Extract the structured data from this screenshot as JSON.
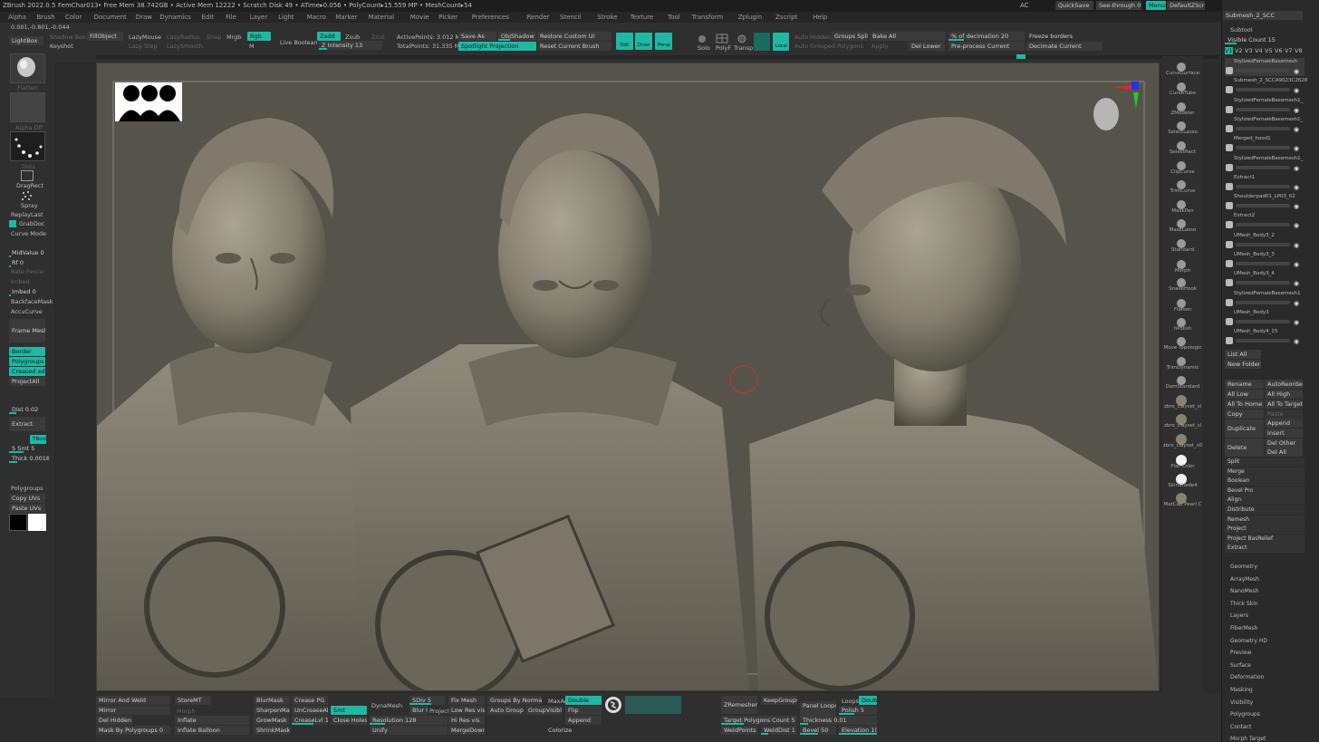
{
  "titlebar": {
    "app": "ZBrush 2022.0.5",
    "doc": "FemChar013",
    "stats": "• Free Mem 38.742GB • Active Mem 12222 • Scratch Disk 49 • ATime▸0.056 • PolyCount▸15.559 MP • MeshCount▸54",
    "ac": "AC",
    "quicksave": "QuickSave",
    "see_through": "See-through  0",
    "menus": "Menus",
    "default_zscript": "DefaultZScript",
    "subtool_tab": "Submesh_2_SCC"
  },
  "menubar": [
    "Alpha",
    "Brush",
    "Color",
    "Document",
    "Draw",
    "Dynamics",
    "Edit",
    "File",
    "Layer",
    "Light",
    "Macro",
    "Marker",
    "Material",
    "Movie",
    "Picker",
    "Preferences",
    "Render",
    "Stencil",
    "Stroke",
    "Texture",
    "Tool",
    "Transform",
    "Zplugin",
    "Zscript",
    "Help"
  ],
  "coords": "0.001,-0.801,-0.044",
  "toolbar": {
    "lightbox": "LightBox",
    "keyshot": "Keyshot",
    "shadow_box": "Shadow Box",
    "fill_object": "FillObject",
    "lazymouse": "LazyMouse",
    "lazy_step": "Lazy Step",
    "lazy_radius": "LazyRadius",
    "lazy_smooth": "LazySmooth",
    "snap": "Snap",
    "mrgb": "Mrgb",
    "rgb": "Rgb",
    "m": "M",
    "live_boolean": "Live Boolean",
    "zadd": "Zadd",
    "zsub": "Zsub",
    "zcut": "Zcut",
    "z_intensity": "Z Intensity 13",
    "active_points": "ActivePoints: 3.012 Mil",
    "total_points": "TotalPoints: 31.335 Mil",
    "save_as": "Save As",
    "spotlight": "Spotlight Projection",
    "obj_shadow": "ObjShadow 0.3",
    "restore_ui": "Restore Custom UI",
    "reset_brush": "Reset Current Brush",
    "edit": "Edit",
    "draw": "Draw",
    "persp": "Persp",
    "solo": "Solo",
    "polyf": "PolyF",
    "transp": "Transp",
    "local": "Local",
    "auto_hidden": "Auto Hidden",
    "groups_split": "Groups Split",
    "bake_all": "Bake All",
    "auto_grouped": "Auto Grouped Polygons",
    "apply": "Apply",
    "del_lower": "Del Lower",
    "pct_decimation": "% of decimation 20",
    "preprocess": "Pre-process Current",
    "freeze_borders": "Freeze borders",
    "decimate_current": "Decimate Current"
  },
  "left": {
    "flatten": "Flatten",
    "alpha_off": "Alpha Off",
    "dots": "Dots",
    "dragrect": "DragRect",
    "spray": "Spray",
    "replay_last": "ReplayLast",
    "grabdoc": "GrabDoc",
    "curve_mode": "Curve Mode",
    "midvalue": "MidValue  0",
    "rf": "Rf  0",
    "rate_fence": "Rate Fence",
    "imbed_label": "Imbed",
    "imbed": "Imbed  0",
    "backface_mask": "BackfaceMask",
    "accucurve": "AccuCurve",
    "frame_mesh": "Frame Mesh",
    "border": "Border",
    "polygroups": "Polygroups",
    "creased_edge": "Creased edge",
    "project_all": "ProjectAll",
    "dist": "Dist 0.02",
    "extract": "Extract",
    "tbord": "TBord",
    "smt": "S Smt  5",
    "thick": "Thick 0.00185",
    "polygroups2": "Polygroups",
    "copy_uvs": "Copy UVs",
    "paste_uvs": "Paste UVs"
  },
  "right_shelf": [
    "CurveSurface",
    "CurveTube",
    "ZModeler",
    "SelectLasso",
    "SelectRect",
    "ClipCurve",
    "TrimCurve",
    "MaskPen",
    "MaskLasso",
    "Standard",
    "Morph",
    "SnakeHook",
    "Flatten",
    "hPolish",
    "Move Topologic",
    "TrimDynamic",
    "DamStandard",
    "zbro_clayset_sl",
    "zbro_clayset_sl",
    "zbro_clayset_s0",
    "Flat Color",
    "SkinShade4",
    "MatCap Pearl C"
  ],
  "subtool": {
    "header": "Subtool",
    "visible_count": "Visible Count  15",
    "versions": [
      "V1",
      "V2",
      "V3",
      "V4",
      "V5",
      "V6",
      "V7",
      "V8"
    ],
    "items": [
      "StylizedFemaleBasemesh",
      "Submesh_2_SCCA9023C2628",
      "StylizedFemaleBasemesh1_",
      "StylizedFemaleBasemesh1_",
      "Merged_hood1",
      "StylizedFemaleBasemesh1_",
      "Extract1",
      "Shoulderpad01_LP03_02",
      "Extract2",
      "UMesh_Body3_2",
      "UMesh_Body3_3",
      "UMesh_Body3_4",
      "StylizedFemaleBasemesh1",
      "UMesh_Body3",
      "UMesh_Body4_15"
    ],
    "list_all": "List All",
    "new_folder": "New Folder",
    "rename": "Rename",
    "autoreorder": "AutoReorder",
    "all_low": "All Low",
    "all_high": "All High",
    "all_to_home": "All To Home",
    "all_to_target": "All To Target",
    "copy": "Copy",
    "paste": "Paste",
    "duplicate": "Duplicate",
    "append": "Append",
    "insert": "Insert",
    "delete": "Delete",
    "del_other": "Del Other",
    "del_all": "Del All",
    "actions": [
      "Split",
      "Merge",
      "Boolean",
      "Bevel Pro",
      "Align",
      "Distribute",
      "Remesh",
      "Project",
      "Project BasRelief",
      "Extract"
    ],
    "panels": [
      "Geometry",
      "ArrayMesh",
      "NanoMesh",
      "Thick Skin",
      "Layers",
      "FiberMesh",
      "Geometry HD",
      "Preview",
      "Surface",
      "Deformation",
      "Masking",
      "Visibility",
      "Polygroups",
      "Contact",
      "Morph Target"
    ]
  },
  "bottom": {
    "mirror_and_weld": "Mirror And Weld",
    "mirror": "Mirror",
    "del_hidden": "Del Hidden",
    "mask_by_polygroups": "Mask By Polygroups 0",
    "store_mt": "StoreMT",
    "morph": "Morph",
    "inflate": "Inflate",
    "inflate_balloon": "Inflate Balloon",
    "blur_mask": "BlurMask",
    "sharpen_mask": "SharpenMask",
    "grow_mask": "GrowMask",
    "shrink_mask": "ShrinkMask",
    "crease_pg": "Crease PG",
    "uncrease_all": "UnCreaseAll",
    "crease_lvl": "CreaseLvl 15",
    "smt": "Smt",
    "close_holes": "Close Holes",
    "dynamesh": "DynaMesh",
    "resolution": "Resolution 128",
    "sdiv": "SDiv 5",
    "blur": "Blur 0",
    "project": "Project",
    "unify": "Unify",
    "fix_mesh": "Fix Mesh",
    "low_res_vis": "Low Res vis",
    "hi_res_vis": "Hi Res vis",
    "merge_down": "MergeDown",
    "groups_by_normals": "Groups By Normals",
    "auto_groups": "Auto Groups",
    "group_visible": "GroupVisible",
    "maxan": "MaxAn",
    "double": "Double",
    "flip": "Flip",
    "append": "Append",
    "colorize": "Colorize",
    "zremesher": "ZRemesher",
    "keep_groups": "KeepGroups",
    "target_poly": "Target Polygons Count 5",
    "weld_points": "WeldPoints",
    "weld_dist": "WeldDist 1",
    "panel_loops": "Panel Loops",
    "loops": "Loops",
    "double2": "Double",
    "polish": "Polish 5",
    "thickness": "Thickness 0.01",
    "bevel": "Bevel 50",
    "elevation": "Elevation 100"
  }
}
